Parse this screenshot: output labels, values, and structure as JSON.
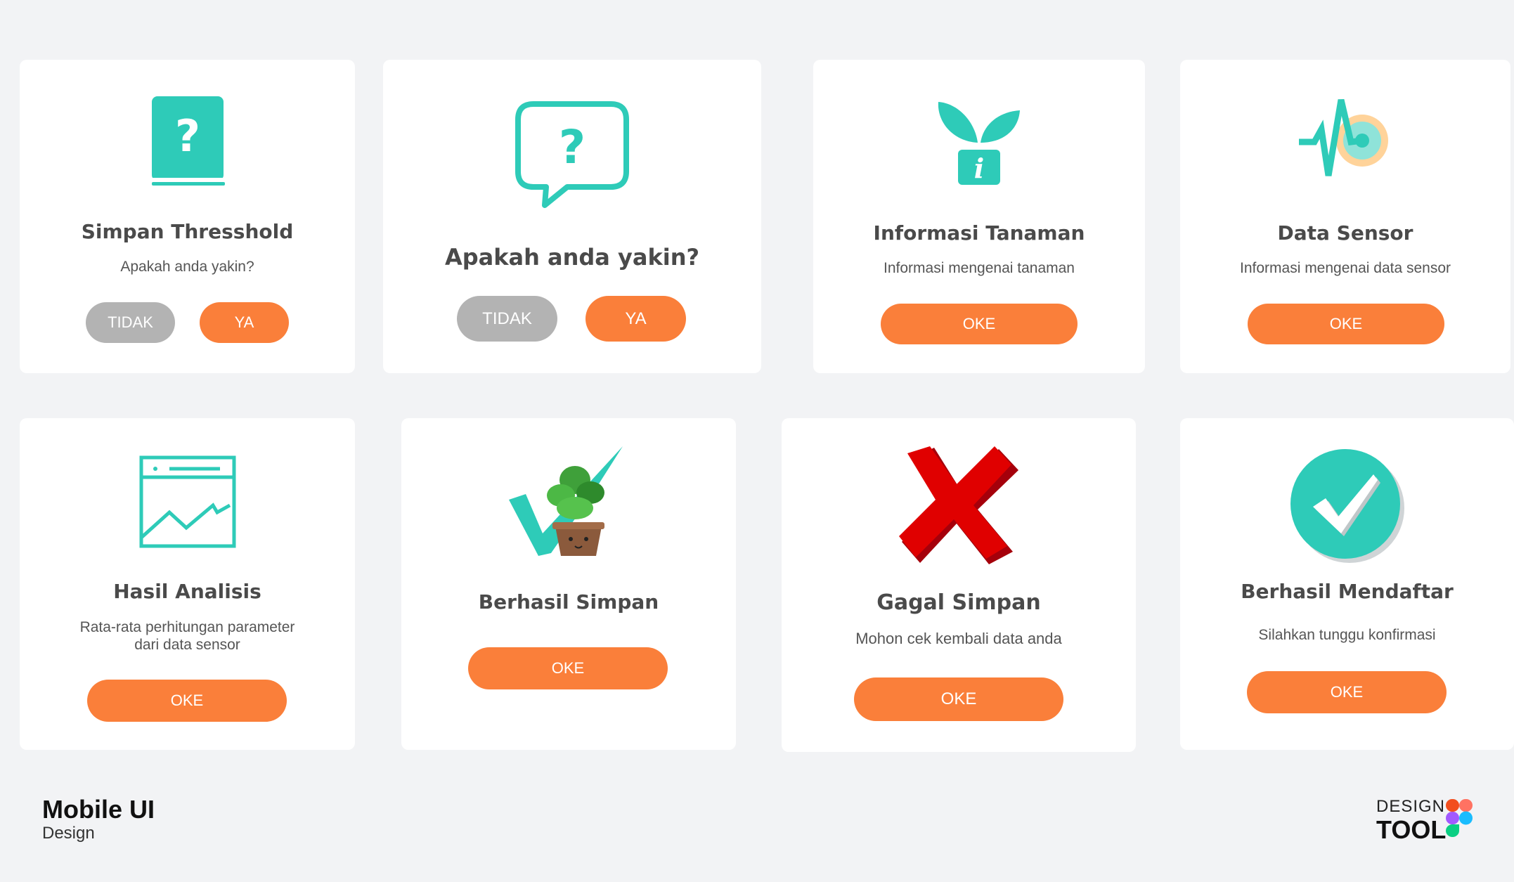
{
  "colors": {
    "accent": "#fa7f3a",
    "teal": "#2ecbb8",
    "grey_button": "#b3b3b3",
    "background": "#f2f3f5"
  },
  "cards": [
    {
      "icon": "question-book-icon",
      "title": "Simpan Thresshold",
      "subtitle": "Apakah anda yakin?",
      "buttons": [
        "TIDAK",
        "YA"
      ]
    },
    {
      "icon": "question-chat-icon",
      "title": "Apakah anda yakin?",
      "buttons": [
        "TIDAK",
        "YA"
      ]
    },
    {
      "icon": "plant-info-icon",
      "title": "Informasi Tanaman",
      "subtitle": "Informasi mengenai tanaman",
      "buttons": [
        "OKE"
      ]
    },
    {
      "icon": "sensor-pulse-icon",
      "title": "Data Sensor",
      "subtitle": "Informasi mengenai data sensor",
      "buttons": [
        "OKE"
      ]
    },
    {
      "icon": "analytics-chart-icon",
      "title": "Hasil Analisis",
      "subtitle_lines": [
        "Rata-rata perhitungan parameter",
        "dari data sensor"
      ],
      "buttons": [
        "OKE"
      ]
    },
    {
      "icon": "plant-check-icon",
      "title": "Berhasil Simpan",
      "buttons": [
        "OKE"
      ]
    },
    {
      "icon": "red-x-icon",
      "title": "Gagal Simpan",
      "subtitle": "Mohon cek kembali data anda",
      "buttons": [
        "OKE"
      ]
    },
    {
      "icon": "teal-check-circle-icon",
      "title": "Berhasil Mendaftar",
      "subtitle": "Silahkan tunggu konfirmasi",
      "buttons": [
        "OKE"
      ]
    }
  ],
  "footer": {
    "title": "Mobile UI",
    "subtitle": "Design",
    "brand_top": "DESIGN",
    "brand_bottom": "TOOL",
    "brand_icon": "figma-logo-icon"
  }
}
